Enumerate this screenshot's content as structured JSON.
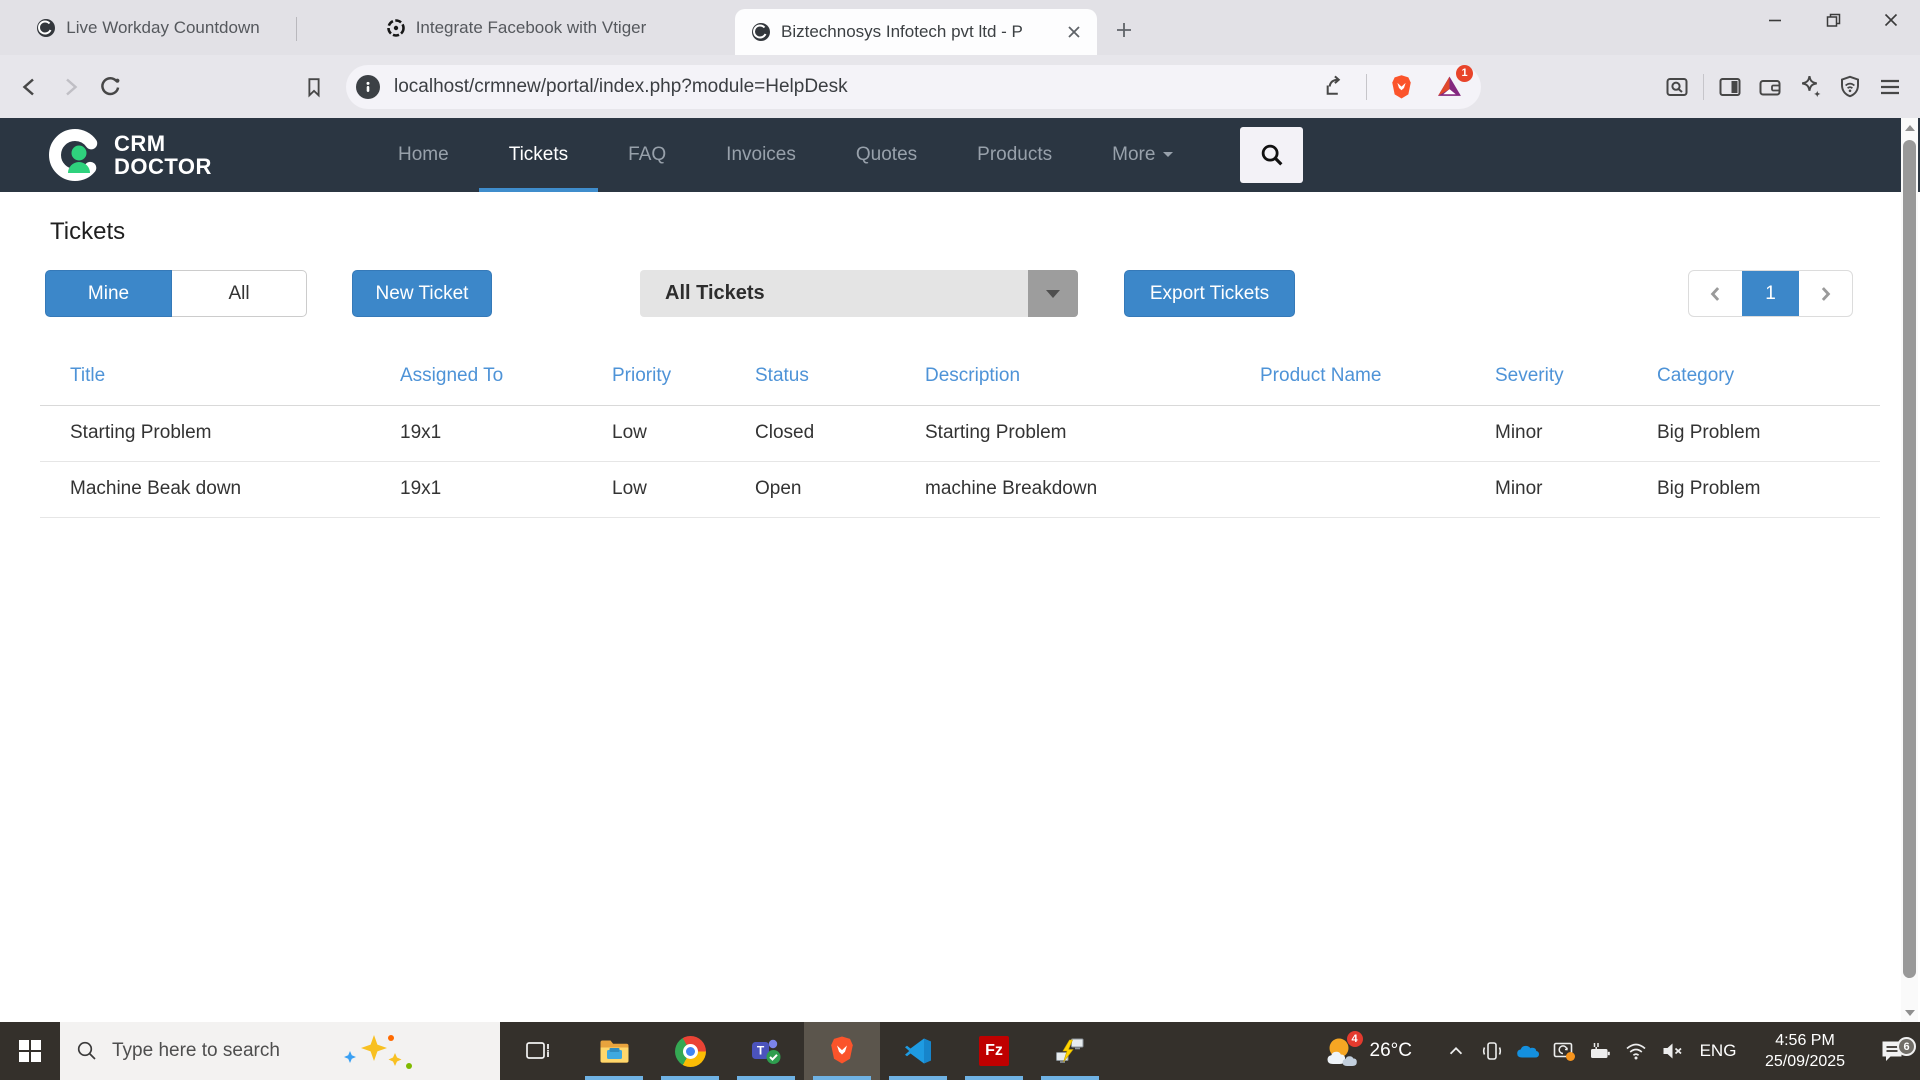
{
  "browser": {
    "tabs": [
      {
        "title": "Live Workday Countdown"
      },
      {
        "title": "Integrate Facebook with Vtiger"
      },
      {
        "title": "Biztechnosys Infotech pvt ltd - P"
      }
    ],
    "url": "localhost/crmnew/portal/index.php?module=HelpDesk",
    "rewards_badge": "1"
  },
  "navbar": {
    "brand_line1": "CRM",
    "brand_line2": "DOCTOR",
    "items": [
      {
        "label": "Home"
      },
      {
        "label": "Tickets"
      },
      {
        "label": "FAQ"
      },
      {
        "label": "Invoices"
      },
      {
        "label": "Quotes"
      },
      {
        "label": "Products"
      },
      {
        "label": "More"
      }
    ]
  },
  "page": {
    "heading": "Tickets",
    "mine_label": "Mine",
    "all_label": "All",
    "new_ticket_label": "New Ticket",
    "filter_value": "All Tickets",
    "export_label": "Export Tickets",
    "pagination_current": "1"
  },
  "table": {
    "headers": [
      "Title",
      "Assigned To",
      "Priority",
      "Status",
      "Description",
      "Product Name",
      "Severity",
      "Category"
    ],
    "rows": [
      {
        "title": "Starting Problem",
        "assigned_to": "19x1",
        "priority": "Low",
        "status": "Closed",
        "description": "Starting Problem",
        "product_name": "",
        "severity": "Minor",
        "category": "Big Problem"
      },
      {
        "title": "Machine Beak down",
        "assigned_to": "19x1",
        "priority": "Low",
        "status": "Open",
        "description": "machine Breakdown",
        "product_name": "",
        "severity": "Minor",
        "category": "Big Problem"
      }
    ]
  },
  "taskbar": {
    "search_placeholder": "Type here to search",
    "temperature": "26°C",
    "weather_badge": "4",
    "language": "ENG",
    "time": "4:56 PM",
    "date": "25/09/2025",
    "notification_count": "6",
    "filezilla_label": "Fz",
    "teams_label": "T"
  },
  "colors": {
    "accent_blue": "#3c87c9",
    "navbar_dark": "#2b3642",
    "brand_green": "#2fd27d",
    "brave_orange": "#fb542b"
  }
}
